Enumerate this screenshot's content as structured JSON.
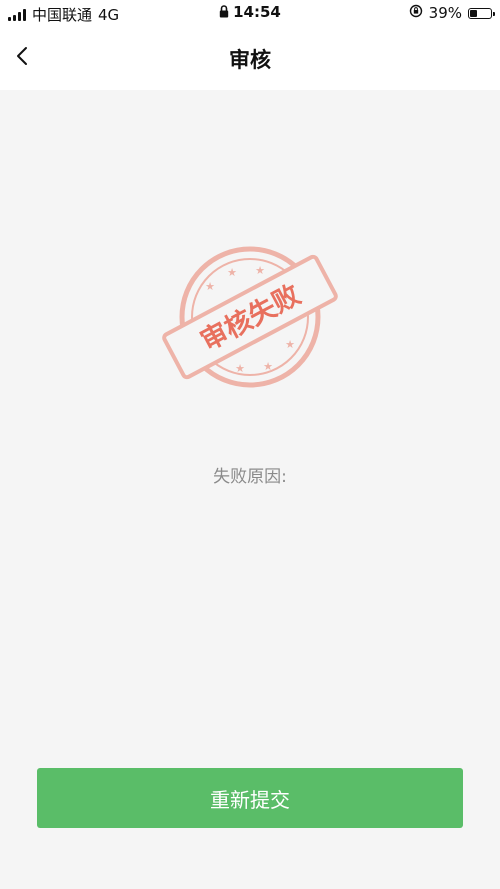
{
  "status_bar": {
    "carrier": "中国联通",
    "network": "4G",
    "time": "14:54",
    "battery_percent": "39%",
    "battery_level": 0.39
  },
  "nav": {
    "title": "审核"
  },
  "stamp": {
    "text": "审核失败",
    "color": "#e8705e"
  },
  "reason": {
    "label": "失败原因:"
  },
  "actions": {
    "resubmit_label": "重新提交",
    "button_color": "#5abd68"
  }
}
